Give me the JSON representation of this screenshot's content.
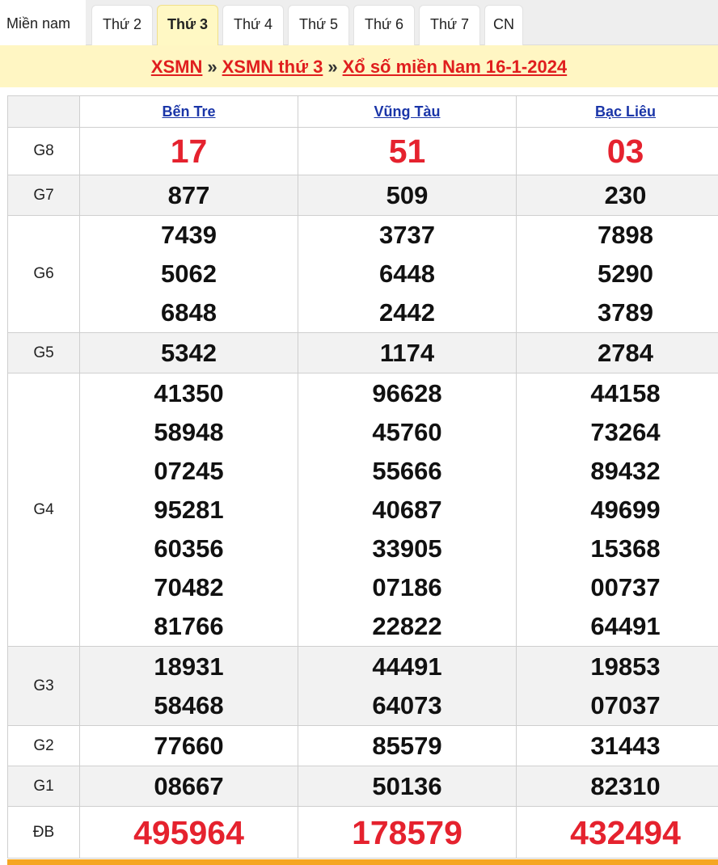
{
  "tabs": [
    "Miền nam",
    "Thứ 2",
    "Thứ 3",
    "Thứ 4",
    "Thứ 5",
    "Thứ 6",
    "Thứ 7",
    "CN"
  ],
  "active_tab": "Thứ 3",
  "breadcrumb": {
    "link1": "XSMN",
    "sep": "»",
    "link2": "XSMN thứ 3",
    "link3": "Xổ số miền Nam 16-1-2024"
  },
  "provinces": [
    "Bến Tre",
    "Vũng Tàu",
    "Bạc Liêu"
  ],
  "prizes": [
    {
      "label": "G8",
      "values": [
        [
          "17"
        ],
        [
          "51"
        ],
        [
          "03"
        ]
      ]
    },
    {
      "label": "G7",
      "values": [
        [
          "877"
        ],
        [
          "509"
        ],
        [
          "230"
        ]
      ]
    },
    {
      "label": "G6",
      "values": [
        [
          "7439",
          "5062",
          "6848"
        ],
        [
          "3737",
          "6448",
          "2442"
        ],
        [
          "7898",
          "5290",
          "3789"
        ]
      ]
    },
    {
      "label": "G5",
      "values": [
        [
          "5342"
        ],
        [
          "1174"
        ],
        [
          "2784"
        ]
      ]
    },
    {
      "label": "G4",
      "values": [
        [
          "41350",
          "58948",
          "07245",
          "95281",
          "60356",
          "70482",
          "81766"
        ],
        [
          "96628",
          "45760",
          "55666",
          "40687",
          "33905",
          "07186",
          "22822"
        ],
        [
          "44158",
          "73264",
          "89432",
          "49699",
          "15368",
          "00737",
          "64491"
        ]
      ]
    },
    {
      "label": "G3",
      "values": [
        [
          "18931",
          "58468"
        ],
        [
          "44491",
          "64073"
        ],
        [
          "19853",
          "07037"
        ]
      ]
    },
    {
      "label": "G2",
      "values": [
        [
          "77660"
        ],
        [
          "85579"
        ],
        [
          "31443"
        ]
      ]
    },
    {
      "label": "G1",
      "values": [
        [
          "08667"
        ],
        [
          "50136"
        ],
        [
          "82310"
        ]
      ]
    },
    {
      "label": "ĐB",
      "values": [
        [
          "495964"
        ],
        [
          "178579"
        ],
        [
          "432494"
        ]
      ]
    }
  ]
}
